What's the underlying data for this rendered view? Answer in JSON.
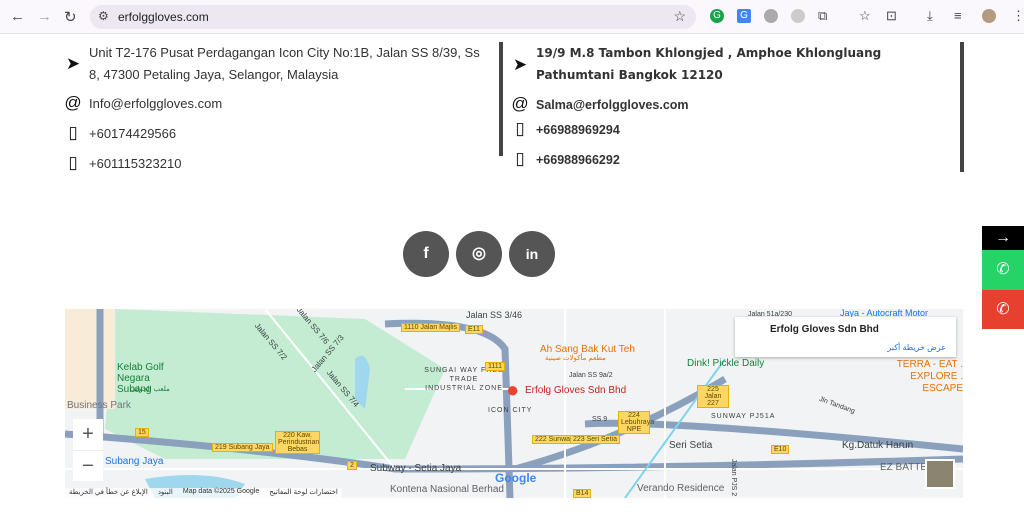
{
  "browser": {
    "url": "erfolggloves.com"
  },
  "contact_left": {
    "address": "Unit T2-176 Pusat Perdagangan Icon City No:1B, Jalan SS 8/39, Ss 8, 47300 Petaling Jaya, Selangor, Malaysia",
    "email": "Info@erfolggloves.com",
    "phone1": "+60174429566",
    "phone2": "+601115323210"
  },
  "contact_right": {
    "address": "19/9 M.8 Tambon Khlongjed , Amphoe Khlongluang Pathumtani Bangkok 12120",
    "email": "Salma@erfolggloves.com",
    "phone1": "+66988969294",
    "phone2": "+66988966292"
  },
  "social": [
    {
      "icon": "facebook",
      "label": "f"
    },
    {
      "icon": "instagram",
      "label": "◎"
    },
    {
      "icon": "linkedin",
      "label": "in"
    }
  ],
  "side_buttons": {
    "arrow": "→",
    "whatsapp": "✆",
    "phone": "✆"
  },
  "map": {
    "card_title": "Erfolg Gloves Sdn Bhd",
    "card_link": "عرض خريطة أكبر",
    "marker_label": "Erfolg Gloves Sdn Bhd",
    "labels": {
      "golf": "Kelab Golf Negara Subang",
      "golf_ar": "ملعب الجولف",
      "business": "Business Park",
      "subang": "Subang Jaya",
      "ftz": "SUNGAI WAY FREE TRADE INDUSTRIAL ZONE",
      "icon_city": "ICON CITY",
      "ahsang": "Ah Sang Bak Kut Teh",
      "ahsang_ar": "مطعم مأكولات صينية",
      "dink": "Dink! Pickle Daily",
      "ss9a": "Jalan SS 9a/2",
      "ss9": "SS 9",
      "sunway_pj": "SUNWAY PJ51A",
      "tandang": "Jln Tandang",
      "terra": "TERRA - EAT . EXPLORE . ESCAPE",
      "seri_setia": "Seri Setia",
      "datuk": "Kg.Datuk Harun",
      "subway": "Subway - Setia Jaya",
      "kontena": "Kontena Nasional Berhad",
      "verando": "Verando Residence",
      "ez": "EZ BATTERY SERVICES",
      "ss72": "Jalan SS 7/2",
      "ss76": "Jalan SS 7/6",
      "ss73": "Jalan SS 7/3",
      "ss74": "Jalan SS 7/4",
      "ss346": "Jalan SS 3/46",
      "jalan51": "Jalan 51a/230",
      "autocraft": "Jaya - Autocraft Motor",
      "pjs": "Jalan PJS 2"
    },
    "shields": {
      "e11": "E11",
      "j1110": "1110 Jalan Majlis",
      "j1111": "1111",
      "s15": "15",
      "s219": "219 Subang Jaya",
      "s220": "220 Kaw. Perindustrian Bebas",
      "s2": "2",
      "s222": "222 Sunway",
      "s223": "223 Seri Setia",
      "s224": "224 Lebuhraya NPE",
      "s225": "225 Jalan 227",
      "e10": "E10",
      "b14": "B14"
    },
    "zoom_in": "+",
    "zoom_out": "−",
    "footer": {
      "report": "الإبلاغ عن خطأ في الخريطة",
      "terms": "البنود",
      "mapdata": "Map data ©2025 Google",
      "shortcuts": "اختصارات لوحة المفاتيح",
      "google": "Google"
    }
  }
}
